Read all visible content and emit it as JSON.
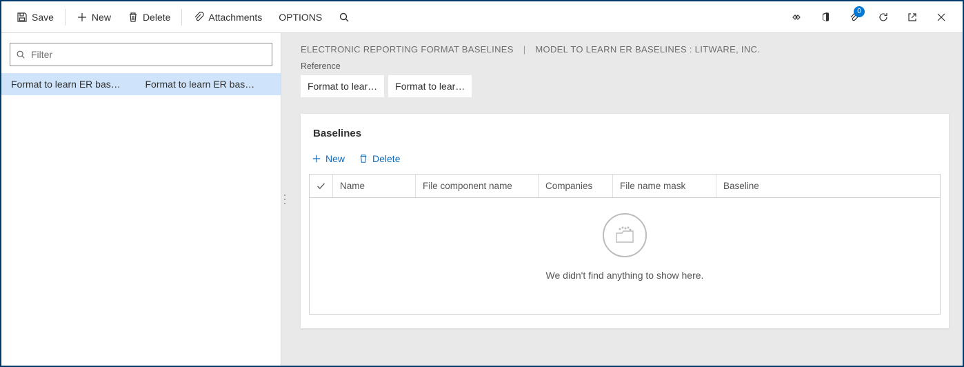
{
  "actionbar": {
    "save": "Save",
    "new": "New",
    "delete": "Delete",
    "attach": "Attachments",
    "options": "OPTIONS"
  },
  "right_icons": {
    "badge_count": "0"
  },
  "left": {
    "filter_placeholder": "Filter",
    "items": [
      {
        "c1": "Format to learn ER bas…",
        "c2": "Format to learn ER bas…",
        "selected": true
      }
    ]
  },
  "breadcrumb": {
    "a": "ELECTRONIC REPORTING FORMAT BASELINES",
    "b": "MODEL TO LEARN ER BASELINES : LITWARE, INC."
  },
  "reference": {
    "label": "Reference",
    "v1": "Format to lear…",
    "v2": "Format to lear…"
  },
  "card": {
    "title": "Baselines",
    "new": "New",
    "delete": "Delete",
    "columns": {
      "name": "Name",
      "component": "File component name",
      "companies": "Companies",
      "mask": "File name mask",
      "baseline": "Baseline"
    },
    "empty": "We didn't find anything to show here."
  }
}
